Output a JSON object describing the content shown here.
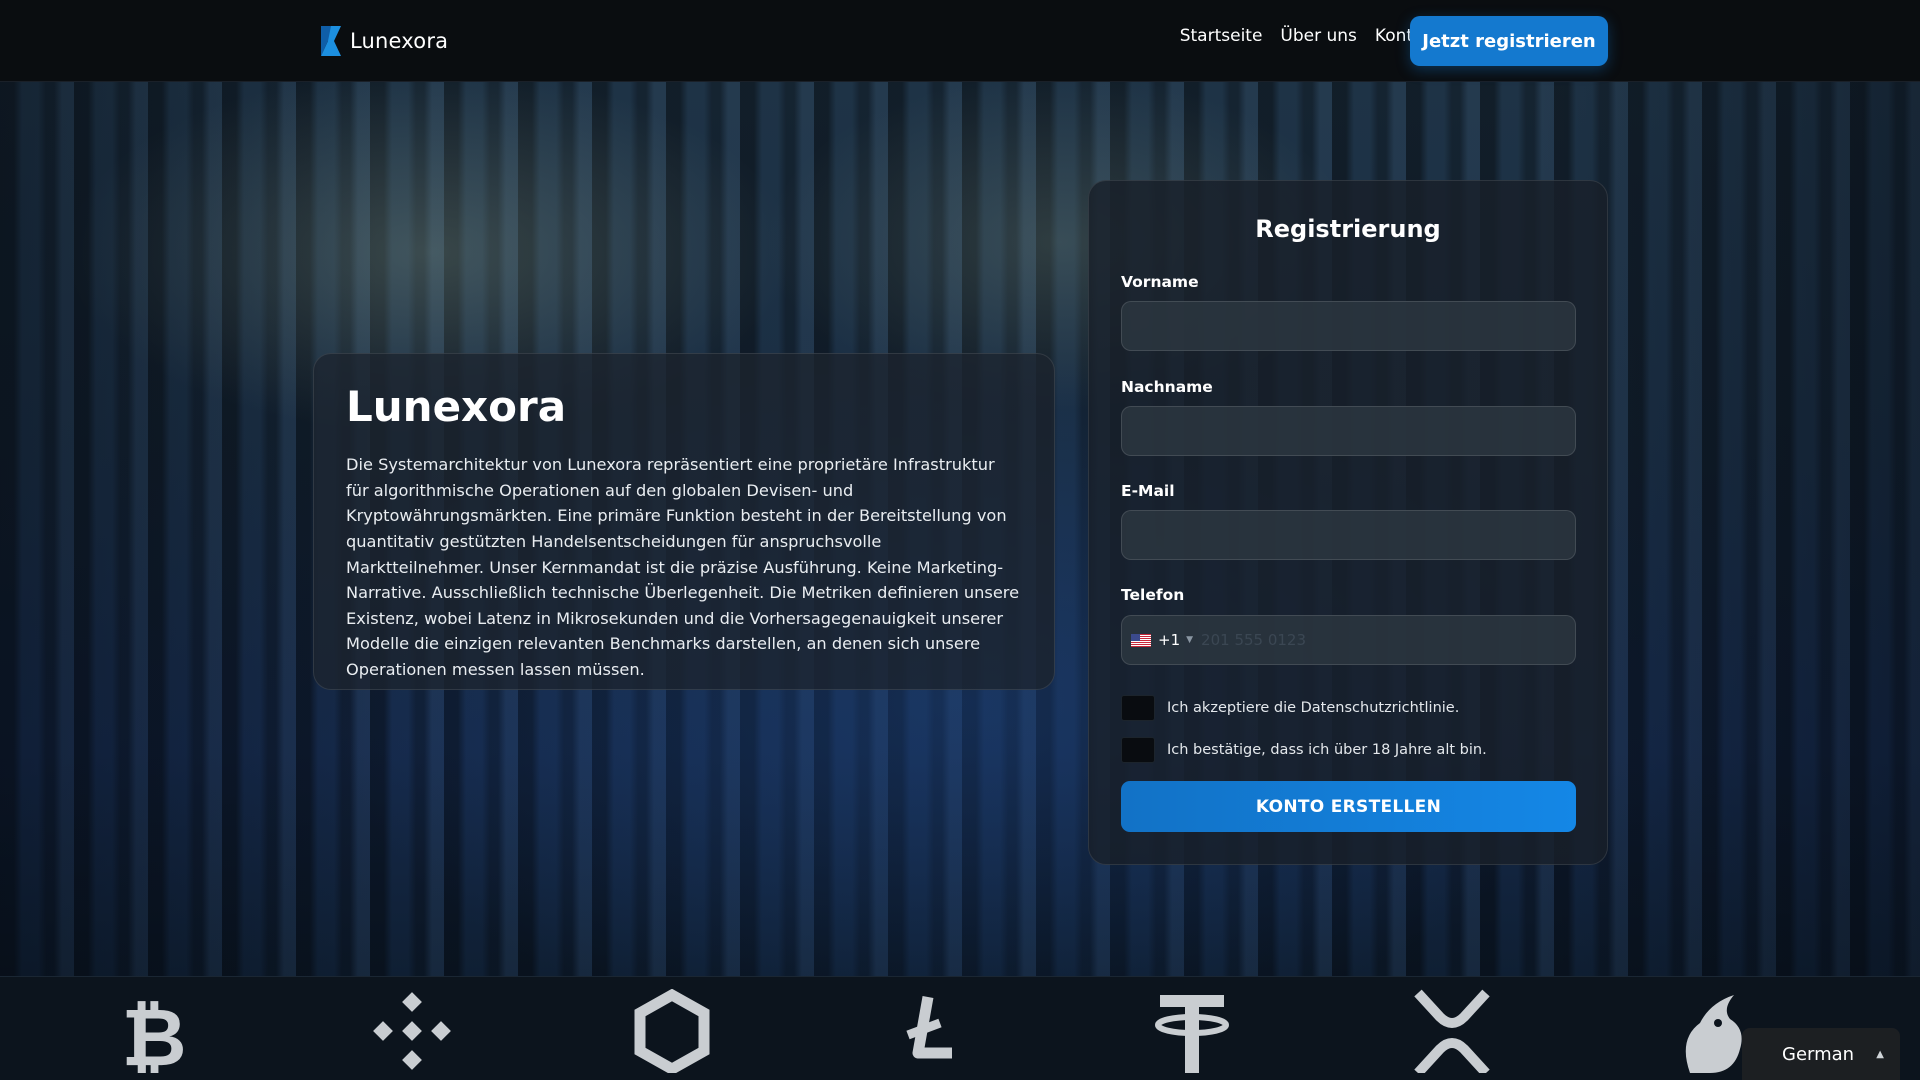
{
  "header": {
    "brand_name": "Lunexora",
    "nav": [
      "Startseite",
      "Über uns",
      "Kontakt"
    ],
    "cta_label": "Jetzt registrieren"
  },
  "info": {
    "title": "Lunexora",
    "text": "Die Systemarchitektur von Lunexora repräsentiert eine proprietäre Infrastruktur für algorithmische Operationen auf den globalen Devisen- und Kryptowährungsmärkten. Eine primäre Funktion besteht in der Bereitstellung von quantitativ gestützten Handelsentscheidungen für anspruchsvolle Marktteilnehmer. Unser Kernmandat ist die präzise Ausführung. Keine Marketing-Narrative. Ausschließlich technische Überlegenheit. Die Metriken definieren unsere Existenz, wobei Latenz in Mikrosekunden und die Vorhersagegenauigkeit unserer Modelle die einzigen relevanten Benchmarks darstellen, an denen sich unsere Operationen messen lassen müssen."
  },
  "form": {
    "title": "Registrierung",
    "first_name_label": "Vorname",
    "first_name_value": "",
    "last_name_label": "Nachname",
    "last_name_value": "",
    "email_label": "E-Mail",
    "email_value": "",
    "phone_label": "Telefon",
    "phone_dial_code": "+1",
    "phone_placeholder": "201 555 0123",
    "phone_value": "",
    "privacy_label": "Ich akzeptiere die Datenschutzrichtlinie.",
    "privacy_checked": false,
    "age_label": "Ich bestätige, dass ich über 18 Jahre alt bin.",
    "age_checked": false,
    "submit_label": "KONTO ERSTELLEN"
  },
  "crypto_icons": [
    "bitcoin-icon",
    "binance-icon",
    "chainlink-icon",
    "litecoin-icon",
    "tether-icon",
    "xrp-icon",
    "uniswap-icon"
  ],
  "language": {
    "selected": "German"
  },
  "colors": {
    "accent": "#1479cf",
    "header_bg": "#0a0d10",
    "card_bg": "#1c242e"
  }
}
